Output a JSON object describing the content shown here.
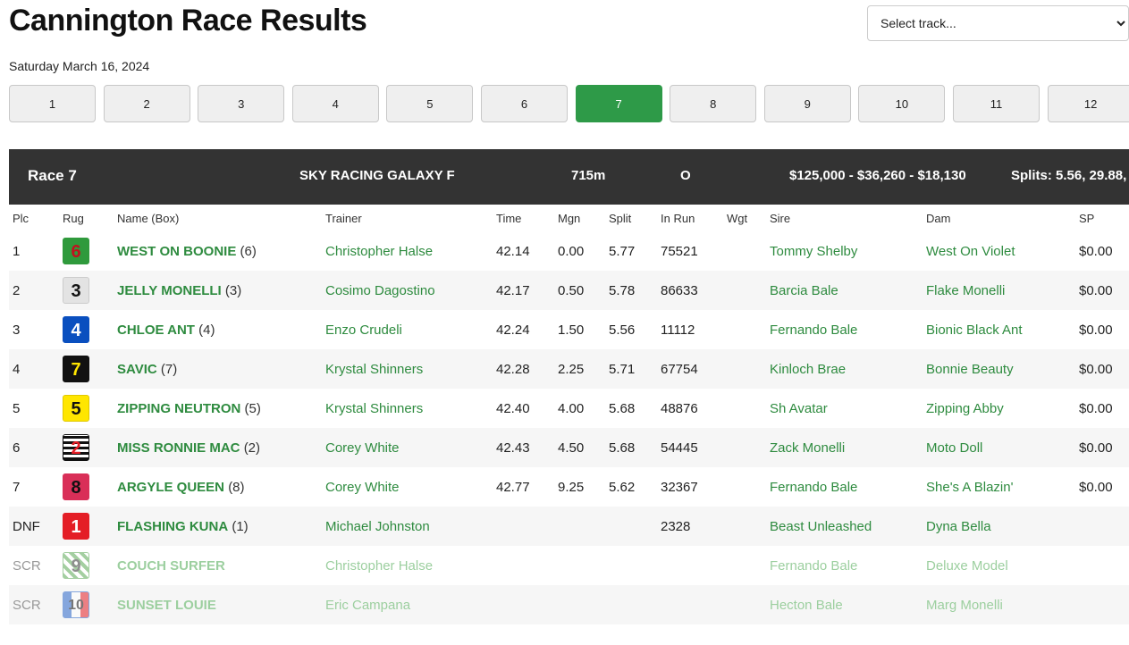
{
  "page_title": "Cannington Race Results",
  "track_select": {
    "placeholder": "Select track..."
  },
  "date": "Saturday March 16, 2024",
  "race_tabs": [
    "1",
    "2",
    "3",
    "4",
    "5",
    "6",
    "7",
    "8",
    "9",
    "10",
    "11",
    "12"
  ],
  "active_race": "7",
  "race_header": {
    "race": "Race 7",
    "name": "SKY RACING GALAXY F",
    "distance": "715m",
    "grade": "O",
    "prizes": "$125,000 - $36,260 - $18,130",
    "splits": "Splits: 5.56, 29.88,"
  },
  "columns": [
    "Plc",
    "Rug",
    "Name (Box)",
    "Trainer",
    "Time",
    "Mgn",
    "Split",
    "In Run",
    "Wgt",
    "Sire",
    "Dam",
    "SP"
  ],
  "colors": {
    "accent": "#2e9a48",
    "header_bg": "#333333",
    "link": "#2e8b3f"
  },
  "runners": [
    {
      "plc": "1",
      "rug": "6",
      "name": "WEST ON BOONIE",
      "box": "(6)",
      "trainer": "Christopher Halse",
      "time": "42.14",
      "mgn": "0.00",
      "split": "5.77",
      "in_run": "75521",
      "wgt": "",
      "sire": "Tommy Shelby",
      "dam": "West On Violet",
      "sp": "$0.00",
      "scratched": false
    },
    {
      "plc": "2",
      "rug": "3",
      "name": "JELLY MONELLI",
      "box": "(3)",
      "trainer": "Cosimo Dagostino",
      "time": "42.17",
      "mgn": "0.50",
      "split": "5.78",
      "in_run": "86633",
      "wgt": "",
      "sire": "Barcia Bale",
      "dam": "Flake Monelli",
      "sp": "$0.00",
      "scratched": false
    },
    {
      "plc": "3",
      "rug": "4",
      "name": "CHLOE ANT",
      "box": "(4)",
      "trainer": "Enzo Crudeli",
      "time": "42.24",
      "mgn": "1.50",
      "split": "5.56",
      "in_run": "11112",
      "wgt": "",
      "sire": "Fernando Bale",
      "dam": "Bionic Black Ant",
      "sp": "$0.00",
      "scratched": false
    },
    {
      "plc": "4",
      "rug": "7",
      "name": "SAVIC",
      "box": "(7)",
      "trainer": "Krystal Shinners",
      "time": "42.28",
      "mgn": "2.25",
      "split": "5.71",
      "in_run": "67754",
      "wgt": "",
      "sire": "Kinloch Brae",
      "dam": "Bonnie Beauty",
      "sp": "$0.00",
      "scratched": false
    },
    {
      "plc": "5",
      "rug": "5",
      "name": "ZIPPING NEUTRON",
      "box": "(5)",
      "trainer": "Krystal Shinners",
      "time": "42.40",
      "mgn": "4.00",
      "split": "5.68",
      "in_run": "48876",
      "wgt": "",
      "sire": "Sh Avatar",
      "dam": "Zipping Abby",
      "sp": "$0.00",
      "scratched": false
    },
    {
      "plc": "6",
      "rug": "2",
      "name": "MISS RONNIE MAC",
      "box": "(2)",
      "trainer": "Corey White",
      "time": "42.43",
      "mgn": "4.50",
      "split": "5.68",
      "in_run": "54445",
      "wgt": "",
      "sire": "Zack Monelli",
      "dam": "Moto Doll",
      "sp": "$0.00",
      "scratched": false
    },
    {
      "plc": "7",
      "rug": "8",
      "name": "ARGYLE QUEEN",
      "box": "(8)",
      "trainer": "Corey White",
      "time": "42.77",
      "mgn": "9.25",
      "split": "5.62",
      "in_run": "32367",
      "wgt": "",
      "sire": "Fernando Bale",
      "dam": "She's A Blazin'",
      "sp": "$0.00",
      "scratched": false
    },
    {
      "plc": "DNF",
      "rug": "1",
      "name": "FLASHING KUNA",
      "box": "(1)",
      "trainer": "Michael Johnston",
      "time": "",
      "mgn": "",
      "split": "",
      "in_run": "2328",
      "wgt": "",
      "sire": "Beast Unleashed",
      "dam": "Dyna Bella",
      "sp": "",
      "scratched": false
    },
    {
      "plc": "SCR",
      "rug": "9",
      "name": "COUCH SURFER",
      "box": "",
      "trainer": "Christopher Halse",
      "time": "",
      "mgn": "",
      "split": "",
      "in_run": "",
      "wgt": "",
      "sire": "Fernando Bale",
      "dam": "Deluxe Model",
      "sp": "",
      "scratched": true
    },
    {
      "plc": "SCR",
      "rug": "10",
      "name": "SUNSET LOUIE",
      "box": "",
      "trainer": "Eric Campana",
      "time": "",
      "mgn": "",
      "split": "",
      "in_run": "",
      "wgt": "",
      "sire": "Hecton Bale",
      "dam": "Marg Monelli",
      "sp": "",
      "scratched": true
    }
  ]
}
